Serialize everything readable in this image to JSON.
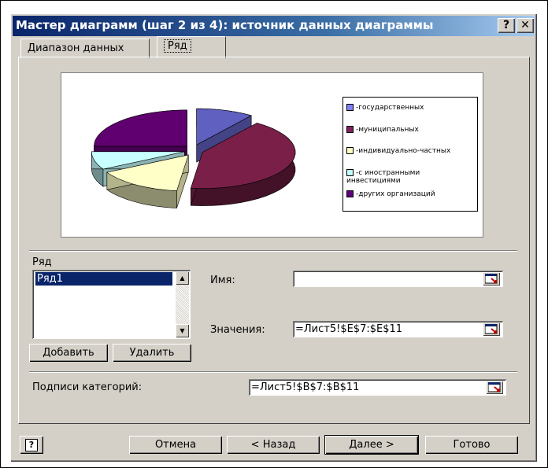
{
  "window": {
    "title": "Мастер диаграмм (шаг 2 из 4): источник данных диаграммы",
    "help_glyph": "?",
    "close_glyph": "✕"
  },
  "tabs": [
    {
      "label": "Диапазон данных",
      "active": false
    },
    {
      "label": "Ряд",
      "active": true
    }
  ],
  "chart": {
    "legend": [
      {
        "label": "-государственных",
        "color": "#8080ff"
      },
      {
        "label": "-муниципальных",
        "color": "#802060"
      },
      {
        "label": "-индивидуально-частных",
        "color": "#ffffc0"
      },
      {
        "label": "-с иностранными инвестициями",
        "color": "#c0ffff"
      },
      {
        "label": "-других организаций",
        "color": "#600080"
      }
    ]
  },
  "chart_data": {
    "type": "pie",
    "style": "3d-exploded",
    "categories": [
      "-государственных",
      "-муниципальных",
      "-индивидуально-частных",
      "-с иностранными инвестициями",
      "-других организаций"
    ],
    "values": [
      10,
      42,
      15,
      8,
      25
    ],
    "colors": [
      "#6060c0",
      "#7a2048",
      "#ffffc8",
      "#c8ffff",
      "#600070"
    ],
    "legend": "right"
  },
  "series_section": {
    "label": "Ряд",
    "items": [
      "Ряд1"
    ],
    "name_label": "Имя:",
    "name_value": "",
    "values_label": "Значения:",
    "values_value": "=Лист5!$E$7:$E$11",
    "add_label": "Добавить",
    "remove_label": "Удалить"
  },
  "categories": {
    "label": "Подписи категорий:",
    "value": "=Лист5!$B$7:$B$11"
  },
  "footer": {
    "help_glyph": "?",
    "cancel": "Отмена",
    "back": "< Назад",
    "next": "Далее >",
    "finish": "Готово"
  }
}
